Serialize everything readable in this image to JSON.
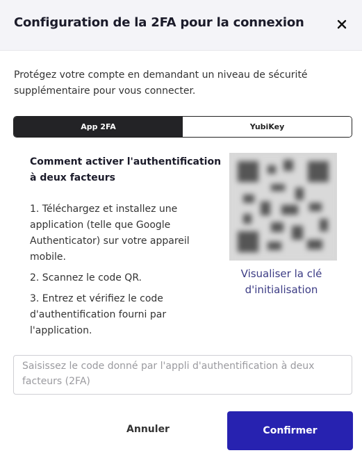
{
  "modal": {
    "title": "Configuration de la 2FA pour la connexion",
    "close_icon": "close-icon"
  },
  "intro": "Protégez votre compte en demandant un niveau de sécurité supplémentaire pour vous connecter.",
  "tabs": [
    {
      "label": "App 2FA",
      "active": true
    },
    {
      "label": "YubiKey",
      "active": false
    }
  ],
  "instructions": {
    "title": "Comment activer l'authentification à deux facteurs",
    "steps": [
      "1. Téléchargez et installez une application (telle que Google Authenticator) sur votre appareil mobile.",
      "2. Scannez le code QR.",
      "3. Entrez et vérifiez le code d'authentification fourni par l'application."
    ]
  },
  "qr": {
    "icon": "qr-code-icon",
    "link": "Visualiser la clé d'initialisation"
  },
  "code_field": {
    "placeholder": "Saisissez le code donné par l'appli d'authentification à deux facteurs (2FA)",
    "value": ""
  },
  "actions": {
    "cancel": "Annuler",
    "confirm": "Confirmer"
  },
  "colors": {
    "accent": "#2722b0",
    "link": "#3b3b84",
    "tab_active": "#232326",
    "header_bg": "#f4f4f8"
  }
}
